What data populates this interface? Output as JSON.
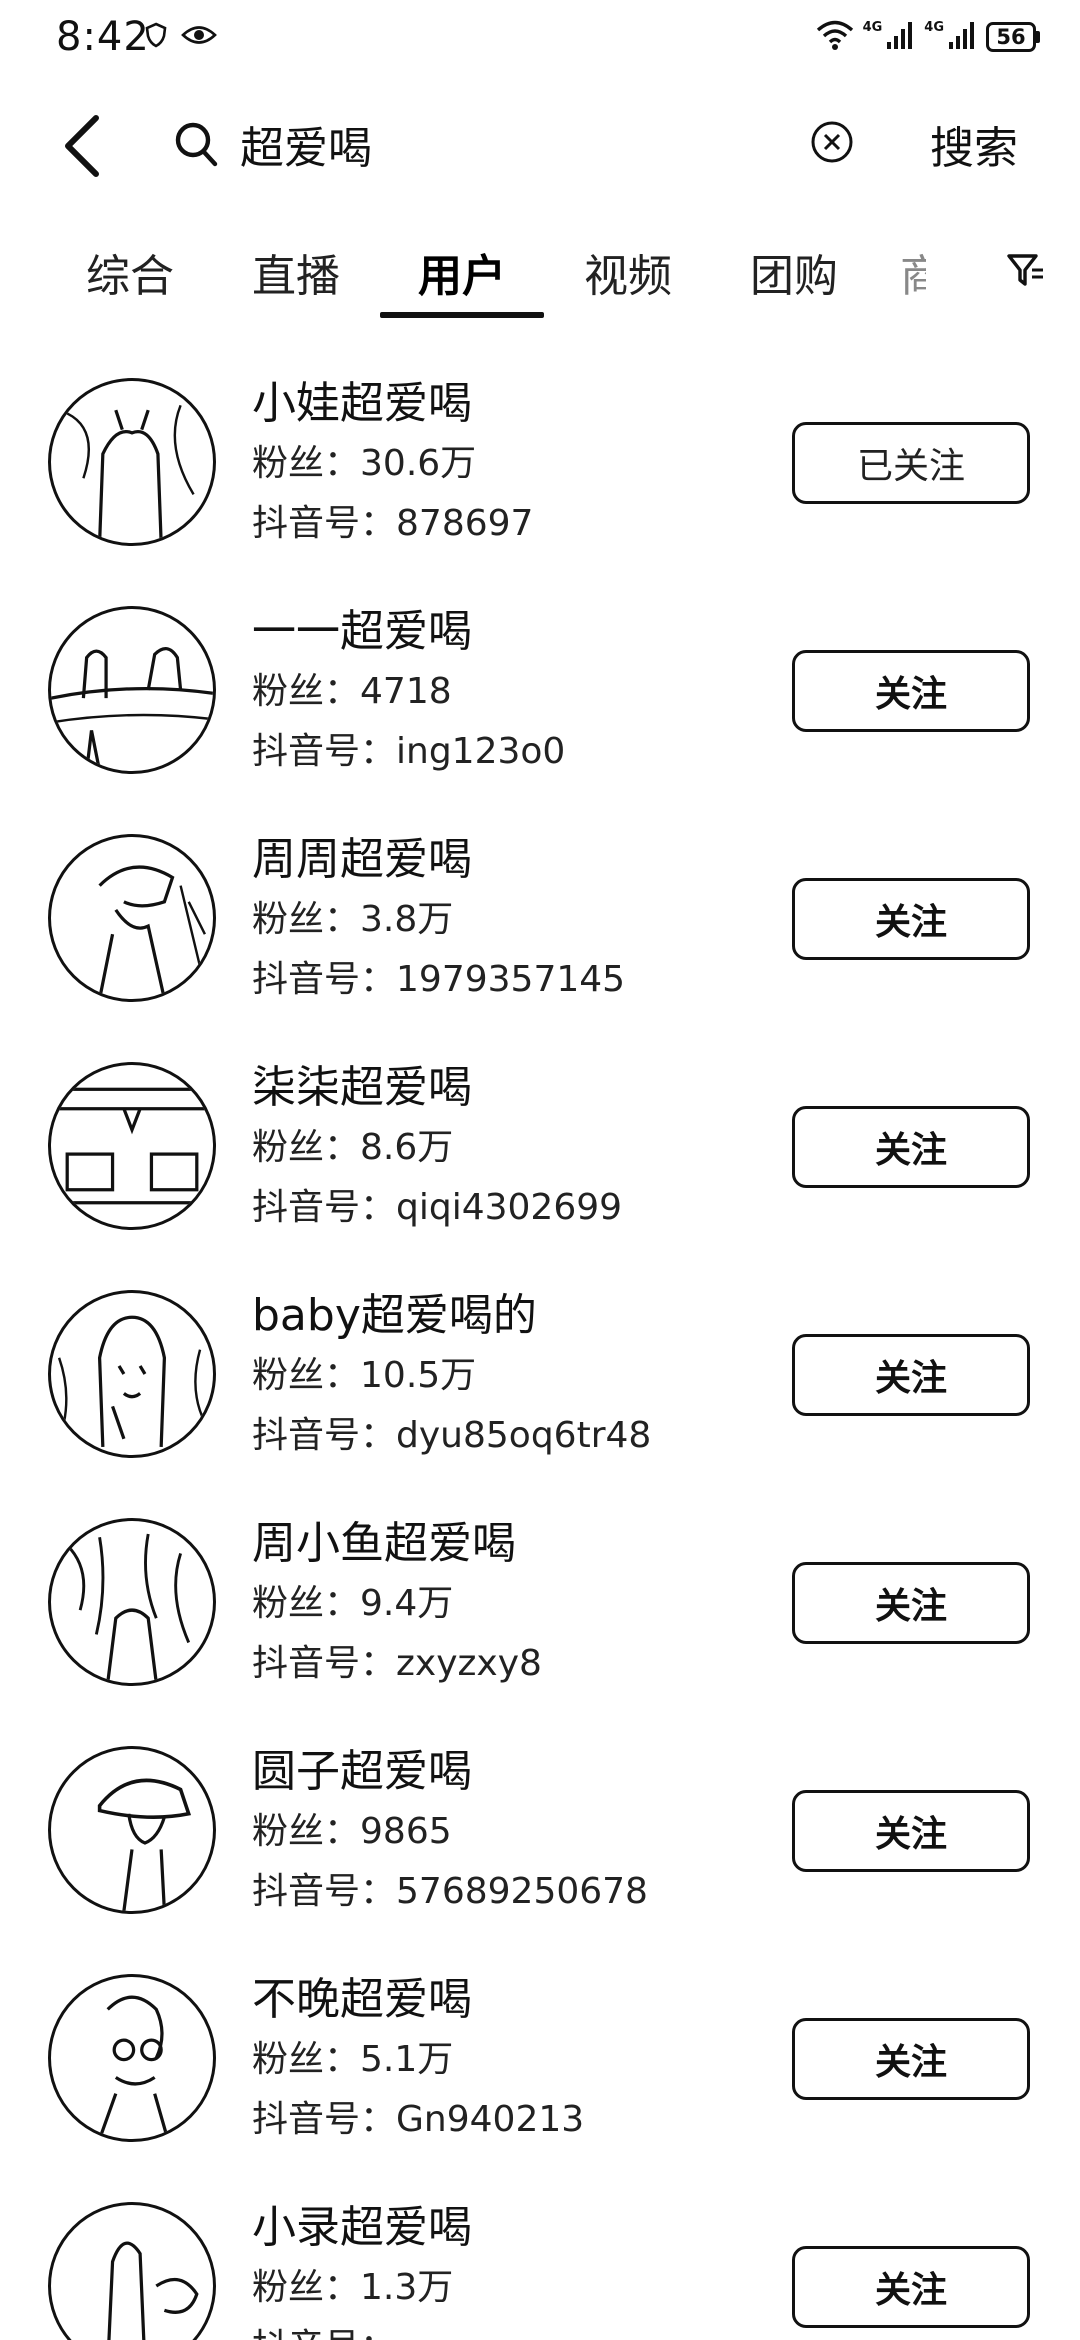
{
  "status_bar": {
    "time": "8:42",
    "network_a": "4G",
    "network_b": "4G",
    "battery": "56"
  },
  "search": {
    "query": "超爱喝",
    "submit_label": "搜索"
  },
  "tabs": {
    "items": [
      {
        "label": "综合"
      },
      {
        "label": "直播"
      },
      {
        "label": "用户"
      },
      {
        "label": "视频"
      },
      {
        "label": "团购"
      }
    ],
    "active": "用户",
    "overflow_partial": "商"
  },
  "labels": {
    "fans_prefix": "粉丝：",
    "id_prefix": "抖音号："
  },
  "users": [
    {
      "name": "小娃超爱喝",
      "fans": "30.6万",
      "id": "878697",
      "follow_label": "已关注",
      "following": true
    },
    {
      "name": "一一超爱喝",
      "fans": "4718",
      "id": "ing123o0",
      "follow_label": "关注",
      "following": false
    },
    {
      "name": "周周超爱喝",
      "fans": "3.8万",
      "id": "1979357145",
      "follow_label": "关注",
      "following": false
    },
    {
      "name": "柒柒超爱喝",
      "fans": "8.6万",
      "id": "qiqi4302699",
      "follow_label": "关注",
      "following": false
    },
    {
      "name": "baby超爱喝的",
      "fans": "10.5万",
      "id": "dyu85oq6tr48",
      "follow_label": "关注",
      "following": false
    },
    {
      "name": "周小鱼超爱喝",
      "fans": "9.4万",
      "id": "zxyzxy8",
      "follow_label": "关注",
      "following": false
    },
    {
      "name": "圆子超爱喝",
      "fans": "9865",
      "id": "57689250678",
      "follow_label": "关注",
      "following": false
    },
    {
      "name": "不晚超爱喝",
      "fans": "5.1万",
      "id": "Gn940213",
      "follow_label": "关注",
      "following": false
    },
    {
      "name": "小录超爱喝",
      "fans": "1.3万",
      "id": "",
      "follow_label": "关注",
      "following": false
    }
  ],
  "icons": {
    "back": "chevron-left-icon",
    "search": "search-icon",
    "clear": "clear-circle-icon",
    "filter": "filter-icon",
    "wifi": "wifi-icon",
    "signal": "signal-icon",
    "shield": "shield-icon",
    "eye": "eye-icon"
  },
  "colors": {
    "text": "#111111",
    "background": "#ffffff",
    "border": "#111111"
  }
}
